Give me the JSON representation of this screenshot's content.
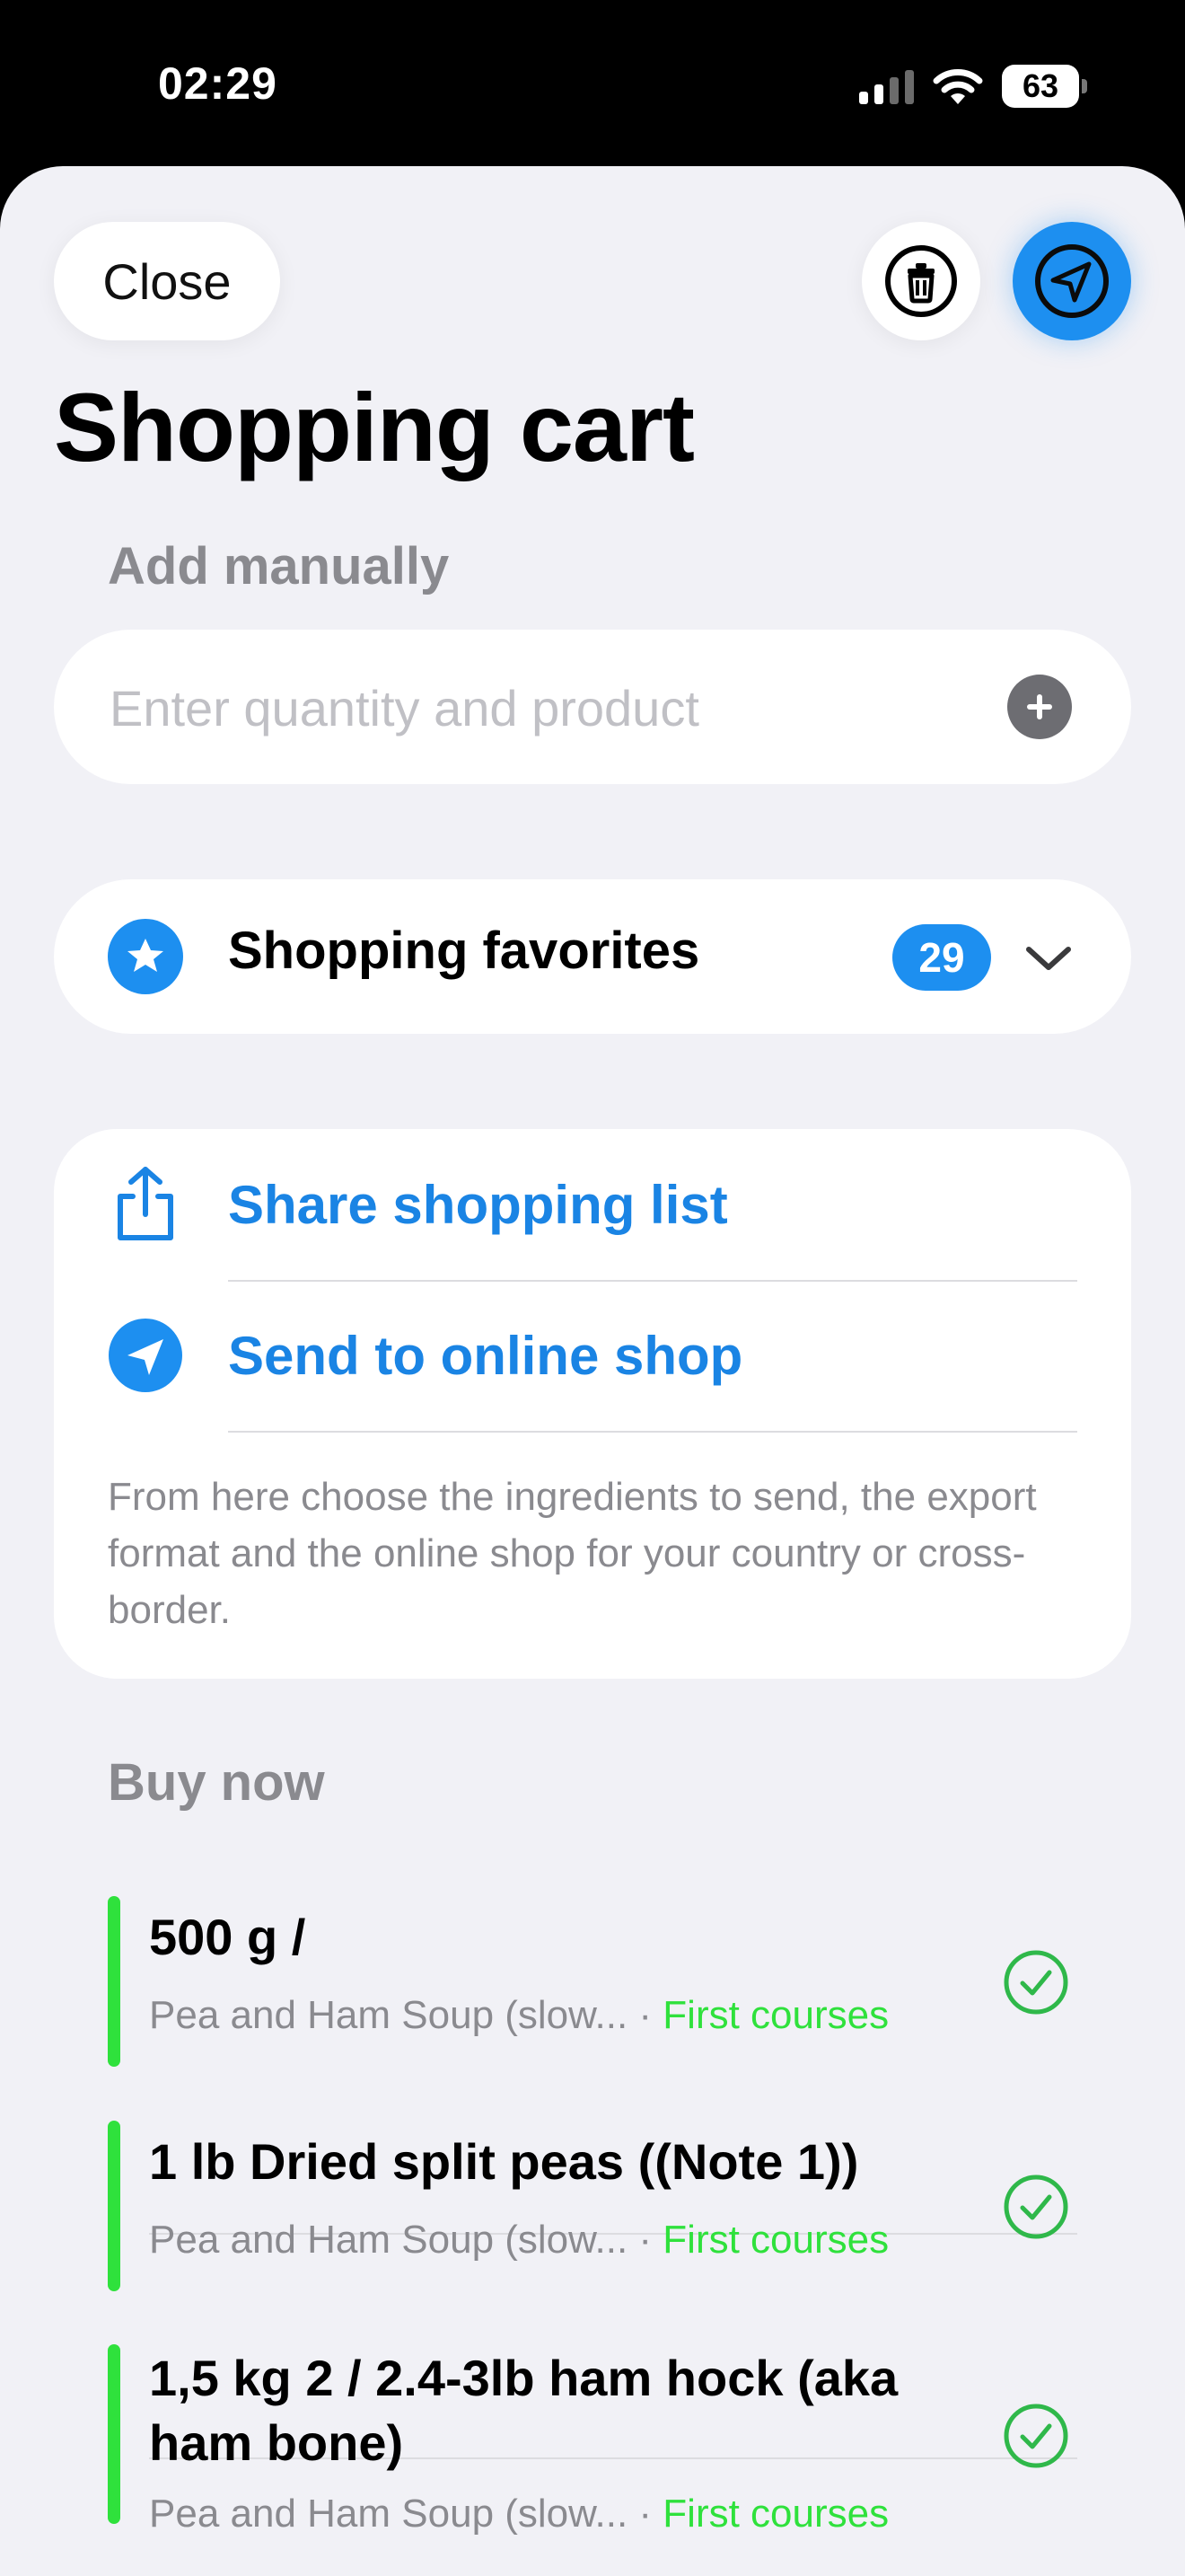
{
  "status_bar": {
    "time": "02:29",
    "battery": "63"
  },
  "header": {
    "close_label": "Close",
    "title": "Shopping cart"
  },
  "add_manually": {
    "label": "Add manually",
    "placeholder": "Enter quantity and product"
  },
  "favorites": {
    "label": "Shopping favorites",
    "count": "29"
  },
  "actions": {
    "share_label": "Share shopping list",
    "send_label": "Send to online shop",
    "note": "From here choose the ingredients to send, the export format and the online shop for your country or cross-border."
  },
  "buy_now": {
    "label": "Buy now",
    "items": [
      {
        "title": "500 g /",
        "recipe": "Pea and Ham Soup (slow...",
        "category": "First courses"
      },
      {
        "title": "1 lb Dried split peas ((Note 1))",
        "recipe": "Pea and Ham Soup (slow...",
        "category": "First courses"
      },
      {
        "title": "1,5 kg 2 / 2.4-3lb ham hock (aka ham bone)",
        "recipe": "Pea and Ham Soup (slow...",
        "category": "First courses"
      }
    ]
  },
  "colors": {
    "accent": "#1d8ff0",
    "link": "#1a84e4",
    "category_green": "#2fe13c",
    "background": "#f1f1f6"
  }
}
